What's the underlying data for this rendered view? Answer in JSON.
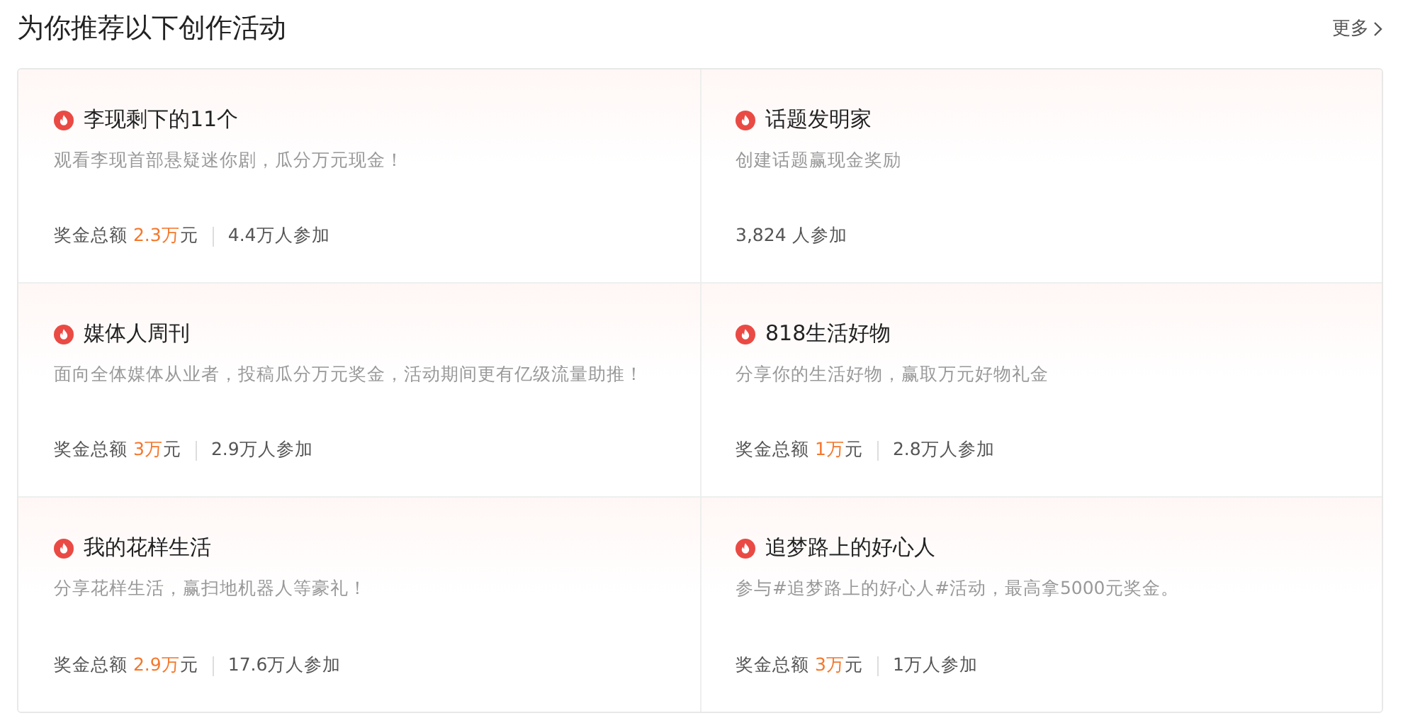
{
  "header": {
    "title": "为你推荐以下创作活动",
    "more_link": "更多"
  },
  "activities": [
    {
      "title": "李现剩下的11个",
      "description": "观看李现首部悬疑迷你剧，瓜分万元现金！",
      "prize_label": "奖金总额",
      "prize_amount": "2.3万",
      "prize_unit": "元",
      "participants": "4.4万人参加"
    },
    {
      "title": "话题发明家",
      "description": "创建话题赢现金奖励",
      "participants": "3,824 人参加"
    },
    {
      "title": "媒体人周刊",
      "description": "面向全体媒体从业者，投稿瓜分万元奖金，活动期间更有亿级流量助推！",
      "prize_label": "奖金总额",
      "prize_amount": "3万",
      "prize_unit": "元",
      "participants": "2.9万人参加"
    },
    {
      "title": "818生活好物",
      "description": "分享你的生活好物，赢取万元好物礼金",
      "prize_label": "奖金总额",
      "prize_amount": "1万",
      "prize_unit": "元",
      "participants": "2.8万人参加"
    },
    {
      "title": "我的花样生活",
      "description": "分享花样生活，赢扫地机器人等豪礼！",
      "prize_label": "奖金总额",
      "prize_amount": "2.9万",
      "prize_unit": "元",
      "participants": "17.6万人参加"
    },
    {
      "title": "追梦路上的好心人",
      "description": "参与#追梦路上的好心人#活动，最高拿5000元奖金。",
      "prize_label": "奖金总额",
      "prize_amount": "3万",
      "prize_unit": "元",
      "participants": "1万人参加"
    }
  ]
}
